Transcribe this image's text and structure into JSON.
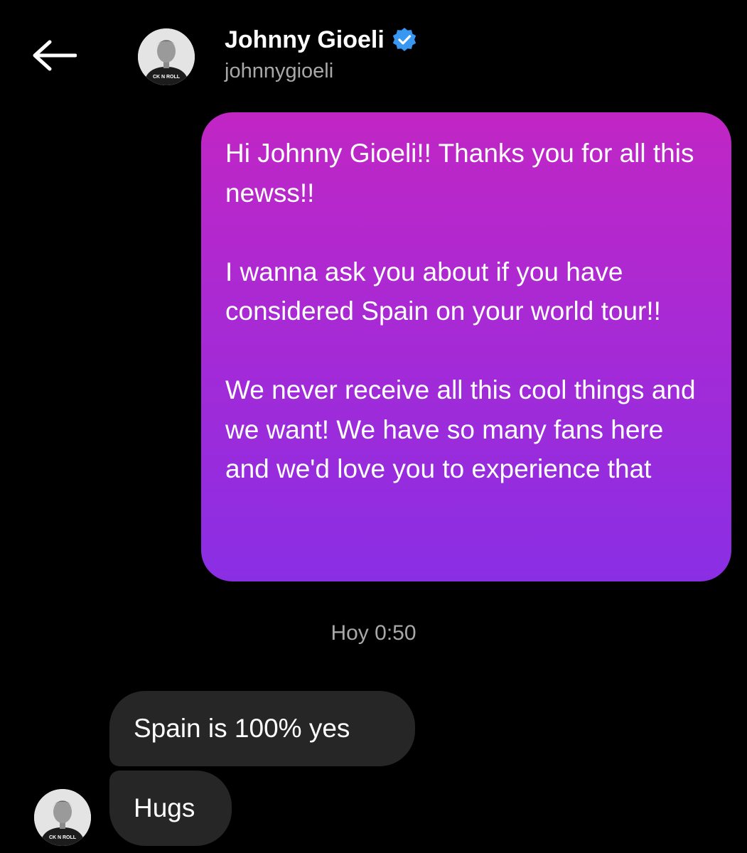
{
  "header": {
    "back_icon": "arrow-left-icon",
    "display_name": "Johnny Gioeli",
    "verified_icon": "verified-badge-icon",
    "verified_color": "#3897f0",
    "username": "johnnygioeli",
    "avatar_shirt_text": "CK N ROLL"
  },
  "conversation": {
    "sent_message": {
      "paragraphs": [
        "Hi Johnny Gioeli!! Thanks you for all this newss!!",
        "I wanna ask you about if you have considered Spain on your world tour!!",
        "We never receive all this cool things and we want! We have so many fans here and we'd love you to experience that"
      ],
      "gradient_colors": [
        "#c126c4",
        "#8a2ee4"
      ]
    },
    "timestamp": "Hoy 0:50",
    "received_messages": [
      "Spain is 100% yes",
      "Hugs"
    ],
    "received_bubble_color": "#262626"
  }
}
